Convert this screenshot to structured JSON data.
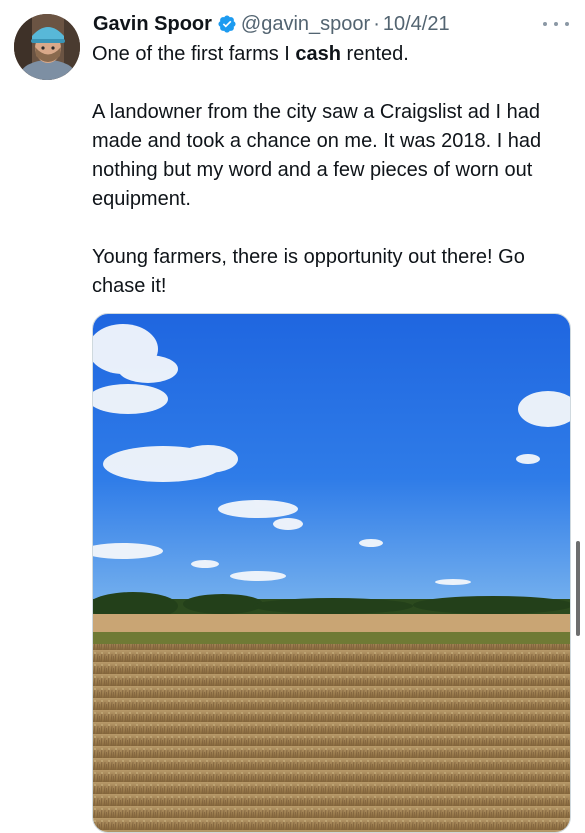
{
  "tweet": {
    "author_name": "Gavin Spoor",
    "handle": "@gavin_spoor",
    "separator": "·",
    "date": "10/4/21",
    "text_intro": "One of the first farms I ",
    "text_bold": "cash",
    "text_outro": " rented.",
    "paragraph_2": "A landowner from the city saw a Craigslist ad I had made and took a chance on me. It was 2018. I had nothing but my word and a few pieces of worn out equipment.",
    "paragraph_3": "Young farmers, there is opportunity out there! Go chase it!"
  },
  "icons": {
    "verified": "verified-badge-icon",
    "more": "more-options-icon"
  },
  "colors": {
    "verified_blue": "#1d9bf0",
    "secondary_text": "#536471",
    "primary_text": "#0f1419"
  }
}
